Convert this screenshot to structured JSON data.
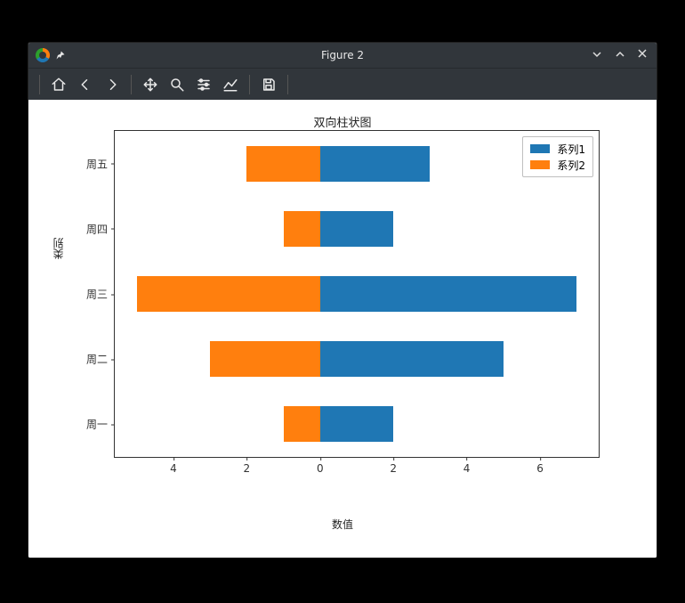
{
  "window": {
    "title": "Figure 2",
    "controls": {
      "min": "⌄",
      "max": "⌃",
      "close": "✕"
    }
  },
  "toolbar": {
    "home": "home-icon",
    "back": "arrow-left-icon",
    "forward": "arrow-right-icon",
    "pan": "move-icon",
    "zoom": "search-icon",
    "configure": "sliders-icon",
    "edit": "chart-line-icon",
    "save": "save-icon"
  },
  "chart_data": {
    "type": "bar",
    "orientation": "horizontal-diverging",
    "title": "双向柱状图",
    "xlabel": "数值",
    "ylabel": "类别",
    "categories": [
      "周一",
      "周二",
      "周三",
      "周四",
      "周五"
    ],
    "series": [
      {
        "name": "系列1",
        "values": [
          2,
          5,
          7,
          2,
          3
        ],
        "color": "#1f77b4"
      },
      {
        "name": "系列2",
        "values": [
          -1,
          -3,
          -5,
          -1,
          -2
        ],
        "color": "#ff7f0e"
      }
    ],
    "xticks": [
      -4,
      -2,
      0,
      2,
      4,
      6
    ],
    "xlim": [
      -5.6,
      7.6
    ],
    "legend_position": "upper-right"
  }
}
